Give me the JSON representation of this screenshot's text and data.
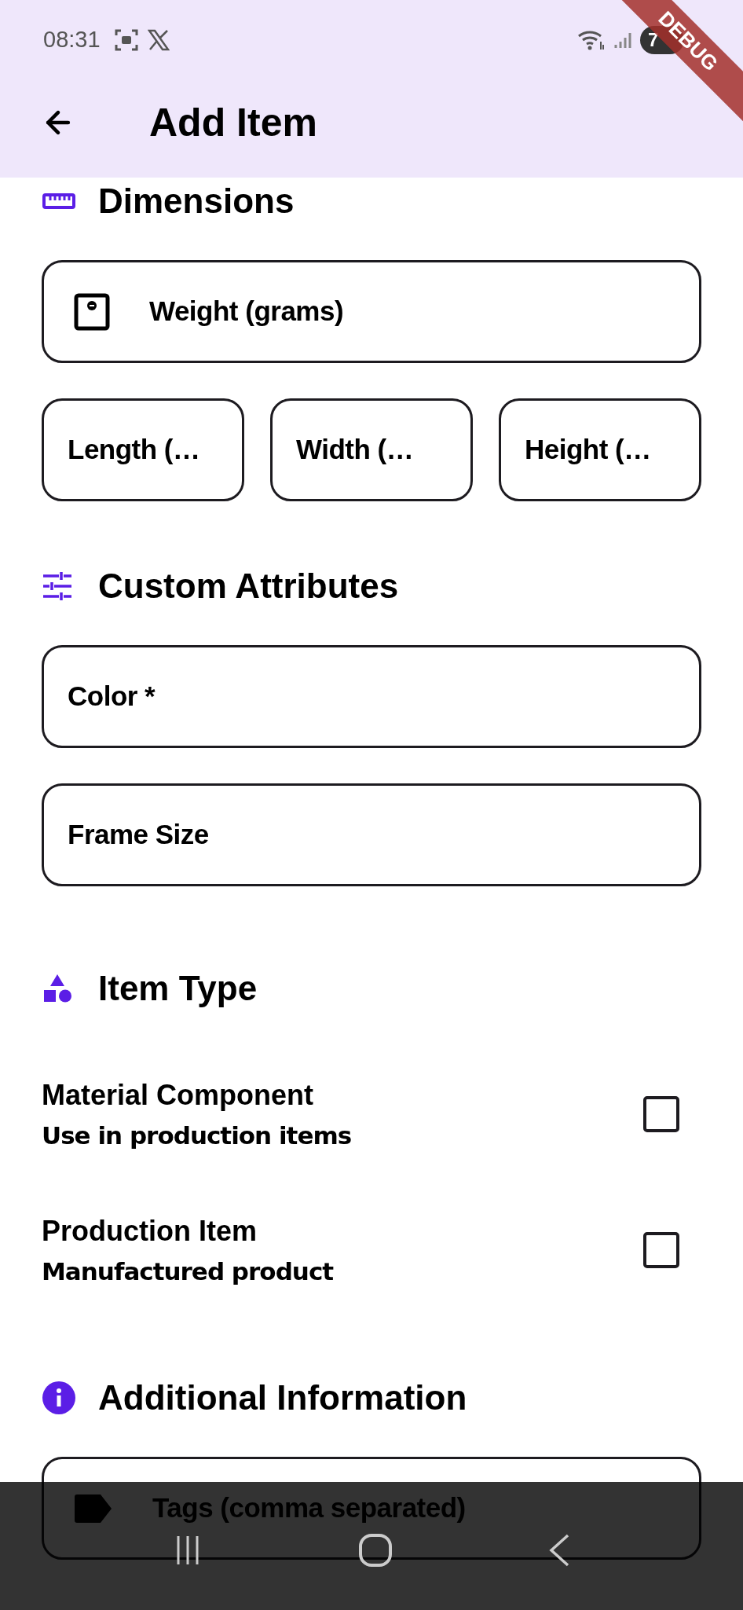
{
  "status_bar": {
    "time": "08:31",
    "battery": "7"
  },
  "debug_banner": "DEBUG",
  "app_bar": {
    "title": "Add Item"
  },
  "sections": [
    {
      "kind": "fields",
      "title": "Dimensions",
      "rows": [
        [
          {
            "label": "Weight (grams)",
            "kind": "leading-icon"
          }
        ],
        [
          {
            "label": "Length (…",
            "kind": "plain"
          },
          {
            "label": "Width (…",
            "kind": "plain"
          },
          {
            "label": "Height (…",
            "kind": "plain"
          }
        ]
      ]
    },
    {
      "kind": "fields",
      "title": "Custom Attributes",
      "rows": [
        [
          {
            "label": "Color *",
            "kind": "plain"
          }
        ],
        [
          {
            "label": "Frame Size",
            "kind": "plain"
          }
        ]
      ]
    },
    {
      "kind": "options",
      "title": "Item Type",
      "options": [
        {
          "title": "Material Component",
          "subtitle": "Use in production items",
          "checked": false
        },
        {
          "title": "Production Item",
          "subtitle": "Manufactured product",
          "checked": false
        }
      ]
    },
    {
      "kind": "fields",
      "title": "Additional Information",
      "rows": [
        [
          {
            "label": "Tags (comma separated)",
            "kind": "leading-icon"
          }
        ]
      ]
    }
  ]
}
